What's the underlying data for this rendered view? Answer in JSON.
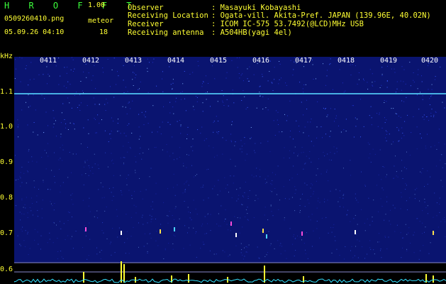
{
  "header": {
    "app_title": "H R O F F T",
    "app_version": "1.00",
    "file_name": "0509260410.png",
    "timestamp": "05.09.26 04:10",
    "meteor_label": "meteor",
    "meteor_count": "18"
  },
  "station": [
    {
      "label": "Observer",
      "value": ": Masayuki Kobayashi"
    },
    {
      "label": "Receiving Location",
      "value": ": Ogata-vill. Akita-Pref. JAPAN (139.96E, 40.02N)"
    },
    {
      "label": "Receiver",
      "value": ": ICOM IC-575 53.7492(@LCD)MHz USB"
    },
    {
      "label": "Receiving antenna",
      "value": ": A504HB(yagi 4el)"
    }
  ],
  "axis": {
    "unit": "kHz",
    "y_ticks": [
      "1.1",
      "1.0",
      "0.9",
      "0.8",
      "0.7",
      "0.6"
    ],
    "x_ticks": [
      "0411",
      "0412",
      "0413",
      "0414",
      "0415",
      "0416",
      "0417",
      "0418",
      "0419",
      "0420"
    ]
  },
  "colors": {
    "background": "#000000",
    "header_text": "#3cff3c",
    "station_text": "#ffff33",
    "spectrum": "#1a2fb0",
    "carrier_line": "#57d6ff",
    "echo_bar": "#ffff33",
    "noise_floor": "#33e0ff"
  }
}
